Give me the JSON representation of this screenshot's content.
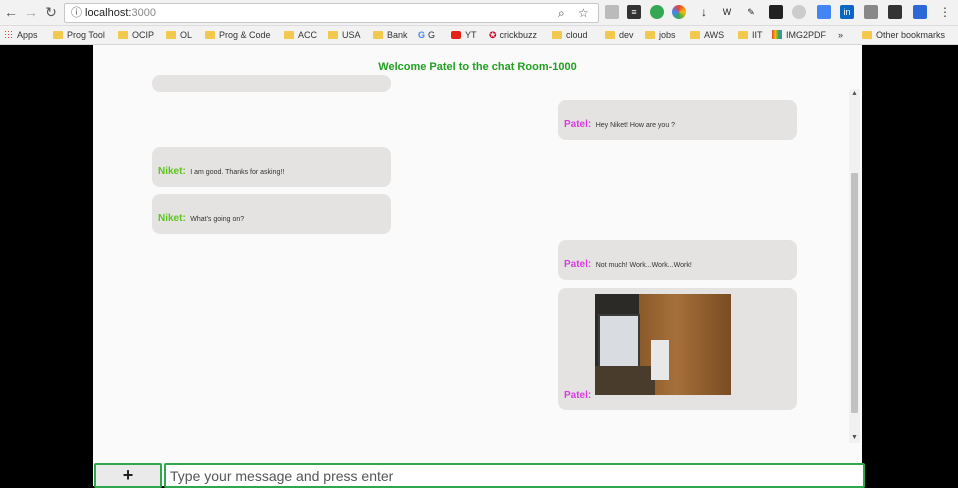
{
  "browser": {
    "url_host": "localhost:",
    "url_port": "3000"
  },
  "bookmarks": [
    "Apps",
    "Prog Tool",
    "OCIP",
    "OL",
    "Prog & Code",
    "ACC",
    "USA",
    "Bank",
    "G",
    "YT",
    "crickbuzz",
    "cloud",
    "dev",
    "jobs",
    "AWS",
    "IIT",
    "IMG2PDF",
    "»",
    "Other bookmarks"
  ],
  "chat": {
    "title": "Welcome Patel to the chat Room-1000",
    "messages": [
      {
        "sender": "Patel:",
        "text": "Hey Niket! How are you ?"
      },
      {
        "sender": "Niket:",
        "text": "I am good. Thanks for asking!!"
      },
      {
        "sender": "Niket:",
        "text": "What's going on?"
      },
      {
        "sender": "Patel:",
        "text": "Not much! Work...Work...Work!"
      },
      {
        "sender": "Patel:",
        "text": ""
      }
    ]
  },
  "composer": {
    "add_label": "+",
    "placeholder": "Type your message and press enter"
  },
  "colors": {
    "title": "#22a022",
    "patel": "#d63be0",
    "niket": "#5cc41a",
    "bubble": "#e5e3e2",
    "border_green": "#2ea84a"
  }
}
